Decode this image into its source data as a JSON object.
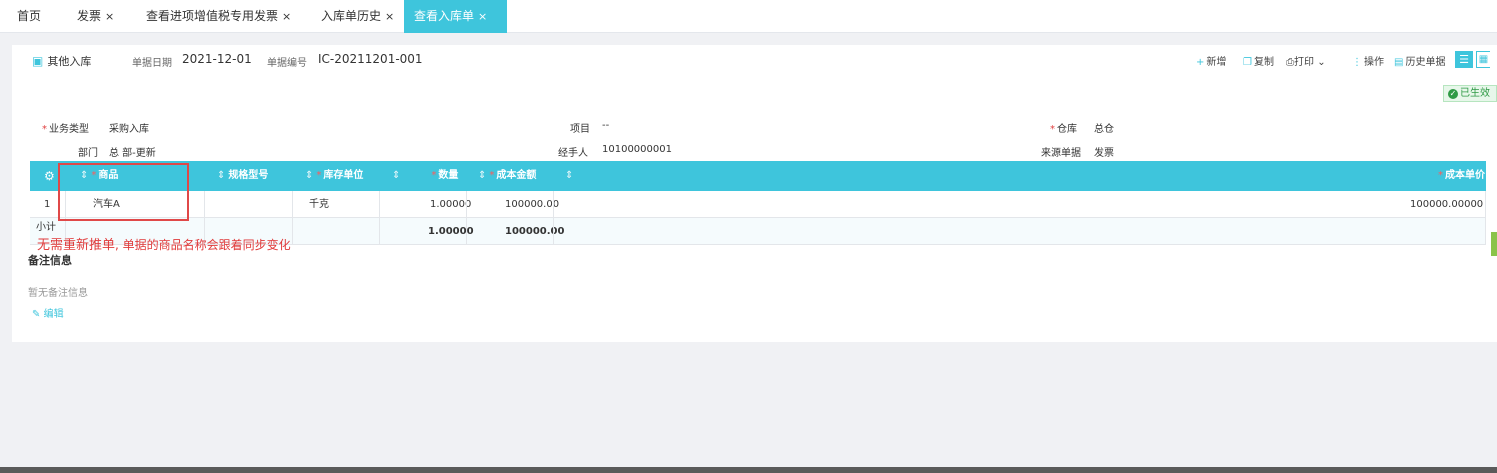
{
  "tabs": [
    {
      "label": "首页",
      "closable": false,
      "active": false
    },
    {
      "label": "发票",
      "closable": true,
      "active": false
    },
    {
      "label": "查看进项增值税专用发票",
      "closable": true,
      "active": false
    },
    {
      "label": "入库单历史",
      "closable": true,
      "active": false
    },
    {
      "label": "查看入库单",
      "closable": true,
      "active": true
    }
  ],
  "close_glyph": "×",
  "doc": {
    "tab_label": "其他入库",
    "date_label": "单据日期",
    "date_value": "2021-12-01",
    "number_label": "单据编号",
    "number_value": "IC-20211201-001",
    "status": "已生效"
  },
  "toolbar": {
    "new": "新增",
    "copy": "复制",
    "print": "打印",
    "ops": "操作",
    "history": "历史单据"
  },
  "fields": {
    "biz_type_label": "业务类型",
    "biz_type_value": "采购入库",
    "project_label": "项目",
    "project_value": "--",
    "warehouse_label": "仓库",
    "warehouse_value": "总仓",
    "dept_label": "部门",
    "dept_value": "总 部-更新",
    "handler_label": "经手人",
    "handler_value": "10100000001",
    "source_label": "来源单据",
    "source_value": "发票"
  },
  "table": {
    "columns": [
      "商品",
      "规格型号",
      "库存单位",
      "数量",
      "成本金额",
      "成本单价"
    ],
    "rows": [
      {
        "no": "1",
        "product": "汽车A",
        "spec": "",
        "unit": "千克",
        "qty": "1.00000",
        "amount": "100000.00",
        "price": "100000.00000"
      }
    ],
    "subtotal_label": "小计",
    "subtotal_qty": "1.00000",
    "subtotal_amount": "100000.00"
  },
  "annotation": {
    "part1": "无需重新推单",
    "part2": "单据的商品名称会跟着同步变化"
  },
  "remarks": {
    "title": "备注信息",
    "empty": "暂无备注信息",
    "edit": "编辑"
  },
  "colors": {
    "accent": "#3ec5dc",
    "required": "#e04040",
    "status_green": "#2f9a45"
  },
  "icons": [
    "settings-gear-icon",
    "sort-icon",
    "doc-icon",
    "plus-icon",
    "copy-icon",
    "print-icon",
    "chevron-down-icon",
    "ops-icon",
    "history-icon",
    "list-view-icon",
    "grid-view-icon",
    "check-circle-icon",
    "edit-icon"
  ]
}
